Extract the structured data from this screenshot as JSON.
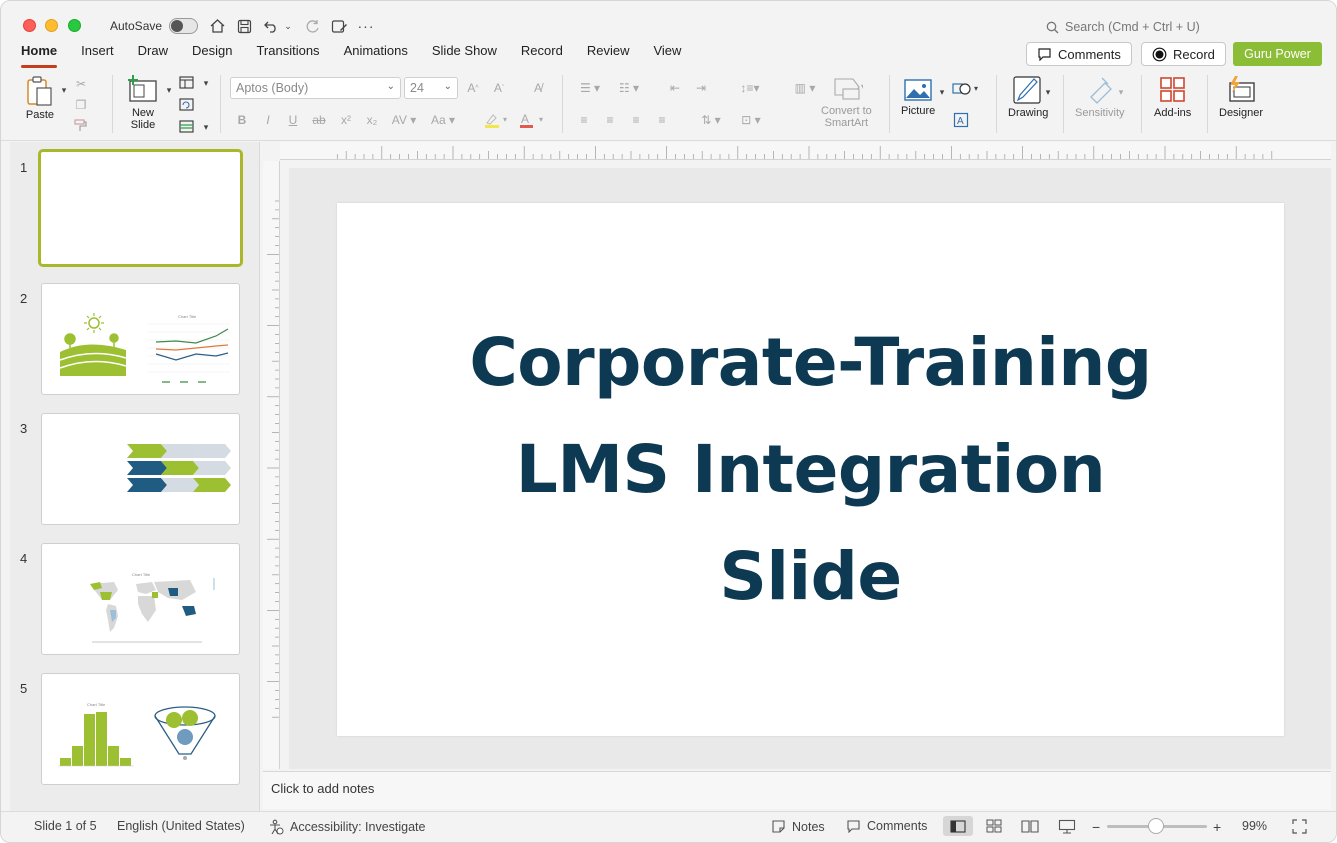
{
  "titlebar": {
    "autosave_label": "AutoSave",
    "search_placeholder": "Search (Cmd + Ctrl + U)"
  },
  "tabs": [
    "Home",
    "Insert",
    "Draw",
    "Design",
    "Transitions",
    "Animations",
    "Slide Show",
    "Record",
    "Review",
    "View"
  ],
  "active_tab": "Home",
  "header_buttons": {
    "comments": "Comments",
    "record": "Record",
    "guru": "Guru Power"
  },
  "ribbon": {
    "paste": "Paste",
    "new_slide_line1": "New",
    "new_slide_line2": "Slide",
    "font_name": "Aptos (Body)",
    "font_size": "24",
    "convert_line1": "Convert to",
    "convert_line2": "SmartArt",
    "picture": "Picture",
    "drawing": "Drawing",
    "sensitivity": "Sensitivity",
    "addins": "Add-ins",
    "designer": "Designer"
  },
  "thumbnails": [
    {
      "num": "1"
    },
    {
      "num": "2"
    },
    {
      "num": "3"
    },
    {
      "num": "4"
    },
    {
      "num": "5"
    }
  ],
  "slide": {
    "line1": "Corporate-Training",
    "line2": "LMS Integration",
    "line3": "Slide"
  },
  "notes_placeholder": "Click to add notes",
  "status": {
    "slide_counter": "Slide 1 of 5",
    "language": "English (United States)",
    "accessibility": "Accessibility: Investigate",
    "notes": "Notes",
    "comments": "Comments",
    "zoom": "99%"
  },
  "colors": {
    "accent_red": "#c43e1c",
    "guru_green": "#8cbd36",
    "title_navy": "#0d3a52",
    "thumb_green": "#9dbf32",
    "thumb_blue": "#205b82"
  }
}
